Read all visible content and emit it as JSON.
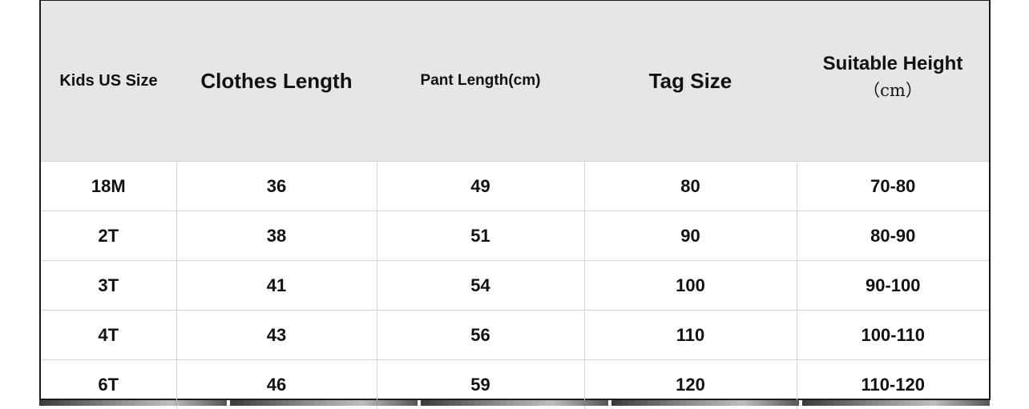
{
  "table": {
    "headers": {
      "size": "Kids US Size",
      "clothes_length": "Clothes Length",
      "pant_length": "Pant Length(cm)",
      "tag_size": "Tag Size",
      "suitable_height": "Suitable Height",
      "suitable_height_unit": "（cm）"
    },
    "rows": [
      [
        "18M",
        "36",
        "49",
        "80",
        "70-80"
      ],
      [
        "2T",
        "38",
        "51",
        "90",
        "80-90"
      ],
      [
        "3T",
        "41",
        "54",
        "100",
        "90-100"
      ],
      [
        "4T",
        "43",
        "56",
        "110",
        "100-110"
      ],
      [
        "6T",
        "46",
        "59",
        "120",
        "110-120"
      ]
    ]
  }
}
